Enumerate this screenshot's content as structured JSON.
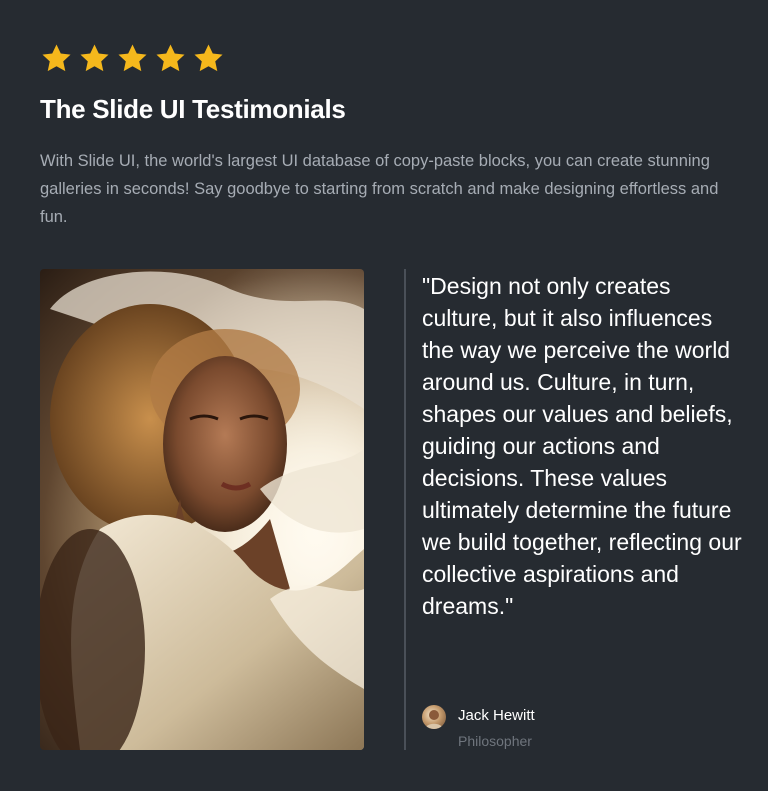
{
  "rating": {
    "stars": 5,
    "max": 5,
    "color": "#f5b81c"
  },
  "testimonial": {
    "title": "The Slide UI Testimonials",
    "description": "With Slide UI, the world's largest UI database of copy-paste blocks, you can create stunning galleries in seconds! Say goodbye to starting from scratch and make designing effortless and fun.",
    "quote": "\"Design not only creates culture, but it also influences the way we perceive the world around us. Culture, in turn, shapes our values and beliefs, guiding our actions and decisions. These values ultimately determine the future we build together, reflecting our collective aspirations and dreams.\"",
    "author": {
      "name": "Jack Hewitt",
      "role": "Philosopher"
    }
  },
  "colors": {
    "background": "#262b31",
    "divider": "#4a5058",
    "muted_text": "#a6acb4"
  }
}
